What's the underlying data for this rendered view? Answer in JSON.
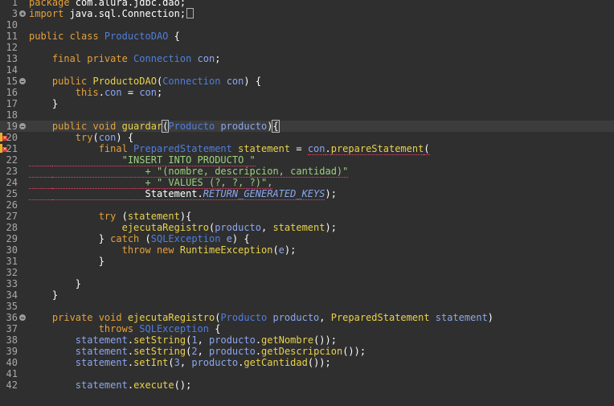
{
  "editor": {
    "file_language": "java",
    "lines": [
      {
        "n": "1",
        "fold": "",
        "error": false,
        "segs": [
          {
            "t": "package ",
            "c": "kw"
          },
          {
            "t": "com.alura.jdbc.dao;",
            "c": ""
          }
        ]
      },
      {
        "n": "3",
        "fold": "plus",
        "error": false,
        "segs": [
          {
            "t": "import ",
            "c": "kw"
          },
          {
            "t": "java.sql.Connection;",
            "c": ""
          }
        ],
        "collapsed_marker": true
      },
      {
        "n": "10",
        "fold": "",
        "error": false,
        "segs": []
      },
      {
        "n": "11",
        "fold": "",
        "error": false,
        "segs": [
          {
            "t": "public class ",
            "c": "kw"
          },
          {
            "t": "ProductoDAO",
            "c": "ty"
          },
          {
            "t": " {",
            "c": ""
          }
        ]
      },
      {
        "n": "12",
        "fold": "",
        "error": false,
        "segs": []
      },
      {
        "n": "13",
        "fold": "",
        "error": false,
        "segs": [
          {
            "t": "    final private ",
            "c": "kw"
          },
          {
            "t": "Connection ",
            "c": "ty"
          },
          {
            "t": "con",
            "c": "vr"
          },
          {
            "t": ";",
            "c": ""
          }
        ]
      },
      {
        "n": "14",
        "fold": "",
        "error": false,
        "segs": []
      },
      {
        "n": "15",
        "fold": "minus",
        "error": false,
        "segs": [
          {
            "t": "    public ",
            "c": "kw"
          },
          {
            "t": "ProductoDAO",
            "c": "mt"
          },
          {
            "t": "(",
            "c": ""
          },
          {
            "t": "Connection ",
            "c": "ty"
          },
          {
            "t": "con",
            "c": "vr"
          },
          {
            "t": ") {",
            "c": ""
          }
        ]
      },
      {
        "n": "16",
        "fold": "",
        "error": false,
        "segs": [
          {
            "t": "        this",
            "c": "kw"
          },
          {
            "t": ".",
            "c": ""
          },
          {
            "t": "con",
            "c": "vr"
          },
          {
            "t": " = ",
            "c": ""
          },
          {
            "t": "con",
            "c": "vr"
          },
          {
            "t": ";",
            "c": ""
          }
        ]
      },
      {
        "n": "17",
        "fold": "",
        "error": false,
        "segs": [
          {
            "t": "    }",
            "c": ""
          }
        ]
      },
      {
        "n": "18",
        "fold": "",
        "error": false,
        "segs": []
      },
      {
        "n": "19",
        "fold": "minus",
        "error": false,
        "current": true,
        "segs": [
          {
            "t": "    public void ",
            "c": "kw"
          },
          {
            "t": "guardar",
            "c": "mt"
          },
          {
            "t": "(",
            "c": "bx"
          },
          {
            "t": "Producto ",
            "c": "ty"
          },
          {
            "t": "producto",
            "c": "vr"
          },
          {
            "t": ")",
            "c": ""
          },
          {
            "t": "{",
            "c": "bx"
          }
        ]
      },
      {
        "n": "20",
        "fold": "",
        "error": true,
        "segs": [
          {
            "t": "        try",
            "c": "kw"
          },
          {
            "t": "(",
            "c": ""
          },
          {
            "t": "con",
            "c": "vr"
          },
          {
            "t": ") {",
            "c": ""
          }
        ]
      },
      {
        "n": "21",
        "fold": "",
        "error": true,
        "segs": [
          {
            "t": "            final ",
            "c": "kw"
          },
          {
            "t": "PreparedStatement ",
            "c": "ty"
          },
          {
            "t": "statement",
            "c": "mt"
          },
          {
            "t": " = ",
            "c": ""
          },
          {
            "t": "con",
            "c": "vr sq"
          },
          {
            "t": ".",
            "c": "sq"
          },
          {
            "t": "prepareStatement",
            "c": "mt sq"
          },
          {
            "t": "(",
            "c": "sq"
          }
        ]
      },
      {
        "n": "22",
        "fold": "",
        "error": false,
        "segs": [
          {
            "t": "    ",
            "c": "ind"
          },
          {
            "t": "            \"INSERT INTO PRODUCTO \"",
            "c": "st sq"
          }
        ]
      },
      {
        "n": "23",
        "fold": "",
        "error": false,
        "segs": [
          {
            "t": "    ",
            "c": "ind"
          },
          {
            "t": "                + \"(nombre, descripcion, cantidad)\"",
            "c": "st sq"
          }
        ]
      },
      {
        "n": "24",
        "fold": "",
        "error": false,
        "segs": [
          {
            "t": "    ",
            "c": "ind"
          },
          {
            "t": "                + \" VALUES (?, ?, ?)\",",
            "c": "st sq"
          }
        ]
      },
      {
        "n": "25",
        "fold": "",
        "error": false,
        "segs": [
          {
            "t": "    ",
            "c": "ind"
          },
          {
            "t": "                Statement.",
            "c": "sq"
          },
          {
            "t": "RETURN_GENERATED_KEYS",
            "c": "vr it sq"
          },
          {
            "t": ");",
            "c": ""
          }
        ]
      },
      {
        "n": "26",
        "fold": "",
        "error": false,
        "segs": []
      },
      {
        "n": "27",
        "fold": "",
        "error": false,
        "segs": [
          {
            "t": "            try ",
            "c": "kw"
          },
          {
            "t": "(",
            "c": ""
          },
          {
            "t": "statement",
            "c": "mt"
          },
          {
            "t": "){",
            "c": ""
          }
        ]
      },
      {
        "n": "28",
        "fold": "",
        "error": false,
        "segs": [
          {
            "t": "                ",
            "c": ""
          },
          {
            "t": "ejecutaRegistro",
            "c": "mt"
          },
          {
            "t": "(",
            "c": ""
          },
          {
            "t": "producto",
            "c": "vr"
          },
          {
            "t": ", ",
            "c": ""
          },
          {
            "t": "statement",
            "c": "mt"
          },
          {
            "t": ");",
            "c": ""
          }
        ]
      },
      {
        "n": "29",
        "fold": "",
        "error": false,
        "segs": [
          {
            "t": "            } ",
            "c": ""
          },
          {
            "t": "catch ",
            "c": "kw"
          },
          {
            "t": "(",
            "c": ""
          },
          {
            "t": "SQLException ",
            "c": "ty"
          },
          {
            "t": "e",
            "c": "vr"
          },
          {
            "t": ") {",
            "c": ""
          }
        ]
      },
      {
        "n": "30",
        "fold": "",
        "error": false,
        "segs": [
          {
            "t": "                throw new ",
            "c": "kw"
          },
          {
            "t": "RuntimeException",
            "c": "mt"
          },
          {
            "t": "(",
            "c": ""
          },
          {
            "t": "e",
            "c": "vr"
          },
          {
            "t": ");",
            "c": ""
          }
        ]
      },
      {
        "n": "31",
        "fold": "",
        "error": false,
        "segs": [
          {
            "t": "            }",
            "c": ""
          }
        ]
      },
      {
        "n": "32",
        "fold": "",
        "error": false,
        "segs": []
      },
      {
        "n": "33",
        "fold": "",
        "error": false,
        "segs": [
          {
            "t": "        }",
            "c": ""
          }
        ]
      },
      {
        "n": "34",
        "fold": "",
        "error": false,
        "segs": [
          {
            "t": "    }",
            "c": ""
          }
        ]
      },
      {
        "n": "35",
        "fold": "",
        "error": false,
        "segs": []
      },
      {
        "n": "36",
        "fold": "minus",
        "error": false,
        "segs": [
          {
            "t": "    private void ",
            "c": "kw"
          },
          {
            "t": "ejecutaRegistro",
            "c": "mt"
          },
          {
            "t": "(",
            "c": ""
          },
          {
            "t": "Producto ",
            "c": "ty"
          },
          {
            "t": "producto",
            "c": "vr"
          },
          {
            "t": ", ",
            "c": ""
          },
          {
            "t": "PreparedStatement ",
            "c": "mt"
          },
          {
            "t": "statement",
            "c": "vr"
          },
          {
            "t": ")",
            "c": ""
          }
        ]
      },
      {
        "n": "37",
        "fold": "",
        "error": false,
        "segs": [
          {
            "t": "            throws ",
            "c": "kw"
          },
          {
            "t": "SQLException",
            "c": "ty"
          },
          {
            "t": " {",
            "c": ""
          }
        ]
      },
      {
        "n": "38",
        "fold": "",
        "error": false,
        "segs": [
          {
            "t": "        statement",
            "c": "vr"
          },
          {
            "t": ".",
            "c": ""
          },
          {
            "t": "setString",
            "c": "mt"
          },
          {
            "t": "(",
            "c": ""
          },
          {
            "t": "1",
            "c": "vr"
          },
          {
            "t": ", ",
            "c": ""
          },
          {
            "t": "producto",
            "c": "vr"
          },
          {
            "t": ".",
            "c": ""
          },
          {
            "t": "getNombre",
            "c": "mt"
          },
          {
            "t": "());",
            "c": ""
          }
        ]
      },
      {
        "n": "39",
        "fold": "",
        "error": false,
        "segs": [
          {
            "t": "        statement",
            "c": "vr"
          },
          {
            "t": ".",
            "c": ""
          },
          {
            "t": "setString",
            "c": "mt"
          },
          {
            "t": "(",
            "c": ""
          },
          {
            "t": "2",
            "c": "vr"
          },
          {
            "t": ", ",
            "c": ""
          },
          {
            "t": "producto",
            "c": "vr"
          },
          {
            "t": ".",
            "c": ""
          },
          {
            "t": "getDescripcion",
            "c": "mt"
          },
          {
            "t": "());",
            "c": ""
          }
        ]
      },
      {
        "n": "40",
        "fold": "",
        "error": false,
        "segs": [
          {
            "t": "        statement",
            "c": "vr"
          },
          {
            "t": ".",
            "c": ""
          },
          {
            "t": "setInt",
            "c": "mt"
          },
          {
            "t": "(",
            "c": ""
          },
          {
            "t": "3",
            "c": "vr"
          },
          {
            "t": ", ",
            "c": ""
          },
          {
            "t": "producto",
            "c": "vr"
          },
          {
            "t": ".",
            "c": ""
          },
          {
            "t": "getCantidad",
            "c": "mt"
          },
          {
            "t": "());",
            "c": ""
          }
        ]
      },
      {
        "n": "41",
        "fold": "",
        "error": false,
        "segs": []
      },
      {
        "n": "42",
        "fold": "",
        "error": false,
        "segs": [
          {
            "t": "        statement",
            "c": "vr"
          },
          {
            "t": ".",
            "c": ""
          },
          {
            "t": "execute",
            "c": "mt"
          },
          {
            "t": "();",
            "c": ""
          }
        ]
      }
    ]
  },
  "colors": {
    "background": "#2f2f2f",
    "keyword": "#e5a03c",
    "type": "#4f7fdd",
    "field": "#8aa7f0",
    "method": "#e9d24a",
    "string": "#9cd07e",
    "error_squiggle": "#ff3e6a"
  },
  "icons": {
    "fold_expand": "fold-expand-icon",
    "fold_collapse": "fold-collapse-icon",
    "error_marker": "error-marker-icon"
  }
}
